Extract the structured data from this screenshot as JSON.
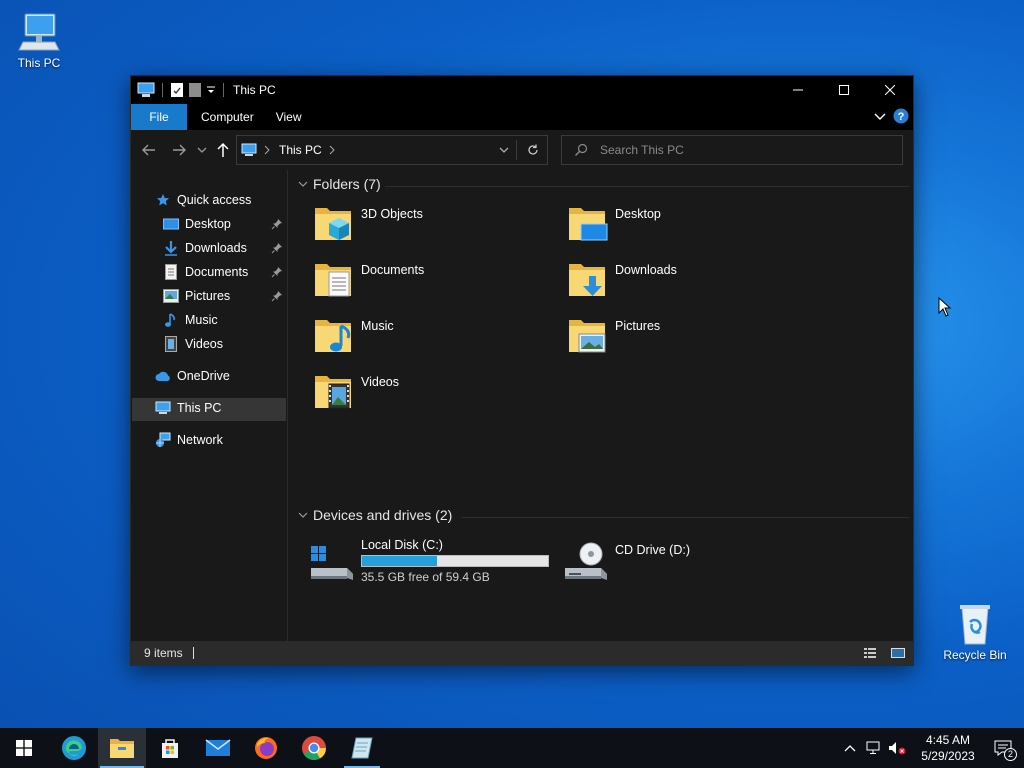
{
  "desktop": {
    "this_pc_label": "This PC",
    "recycle_bin_label": "Recycle Bin"
  },
  "window": {
    "title": "This PC",
    "ribbon_tabs": [
      "File",
      "Computer",
      "View"
    ],
    "address_text": "This PC",
    "search_placeholder": "Search This PC"
  },
  "sidebar": {
    "quick_access": "Quick access",
    "items": [
      {
        "label": "Desktop",
        "icon": "desktop-icon",
        "pinned": true
      },
      {
        "label": "Downloads",
        "icon": "downloads-icon",
        "pinned": true
      },
      {
        "label": "Documents",
        "icon": "documents-icon",
        "pinned": true
      },
      {
        "label": "Pictures",
        "icon": "pictures-icon",
        "pinned": true
      },
      {
        "label": "Music",
        "icon": "music-icon",
        "pinned": false
      },
      {
        "label": "Videos",
        "icon": "videos-icon",
        "pinned": false
      }
    ],
    "onedrive": "OneDrive",
    "this_pc": "This PC",
    "network": "Network"
  },
  "content": {
    "folders_header": "Folders (7)",
    "folders": [
      {
        "label": "3D Objects",
        "overlay": "cube"
      },
      {
        "label": "Desktop",
        "overlay": "desktop"
      },
      {
        "label": "Documents",
        "overlay": "doc"
      },
      {
        "label": "Downloads",
        "overlay": "download"
      },
      {
        "label": "Music",
        "overlay": "music"
      },
      {
        "label": "Pictures",
        "overlay": "picture"
      },
      {
        "label": "Videos",
        "overlay": "video"
      }
    ],
    "drives_header": "Devices and drives (2)",
    "drives": [
      {
        "label": "Local Disk (C:)",
        "free_text": "35.5 GB free of 59.4 GB",
        "used_fraction": 0.402
      },
      {
        "label": "CD Drive (D:)"
      }
    ]
  },
  "status": {
    "items_count": "9 items"
  },
  "taskbar": {
    "time": "4:45 AM",
    "date": "5/29/2023",
    "notification_count": "2"
  },
  "colors": {
    "accent": "#1979ca",
    "folder": "#f3c55c",
    "drive_fill": "#26a0da"
  }
}
